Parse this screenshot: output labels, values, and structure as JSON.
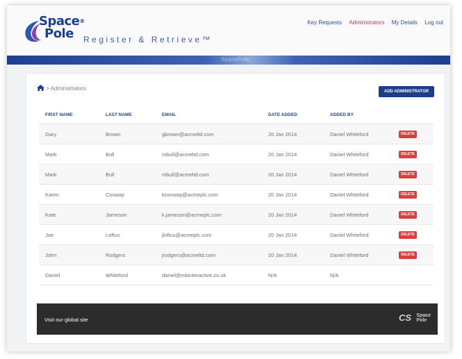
{
  "brand": {
    "line1": "Space",
    "line2": "Pole",
    "reg": "®",
    "tagline": "Register & Retrieve™",
    "band_label": "SpacePole"
  },
  "nav": [
    {
      "label": "Key Requests"
    },
    {
      "label": "Administrators",
      "active": true
    },
    {
      "label": "My Details"
    },
    {
      "label": "Log out"
    }
  ],
  "breadcrumb": {
    "text": "> Administrators"
  },
  "add_button": "ADD ADMINISTRATOR",
  "table": {
    "headers": [
      "FIRST NAME",
      "LAST NAME",
      "EMAIL",
      "DATE ADDED",
      "ADDED BY",
      ""
    ],
    "rows": [
      {
        "first": "Gary",
        "last": "Brown",
        "email": "gbrown@acmeltd.com",
        "date": "20 Jan 2014",
        "added_by": "Daniel Whiteford",
        "action": "DELETE"
      },
      {
        "first": "Mark",
        "last": "Bull",
        "email": "mbull@acmeltd.com",
        "date": "20 Jan 2014",
        "added_by": "Daniel Whiteford",
        "action": "DELETE"
      },
      {
        "first": "Mark",
        "last": "Bull",
        "email": "mbull@acmeltd.com",
        "date": "20 Jan 2014",
        "added_by": "Daniel Whiteford",
        "action": "DELETE"
      },
      {
        "first": "Karen",
        "last": "Conway",
        "email": "kconway@acmeplc.com",
        "date": "20 Jan 2014",
        "added_by": "Daniel Whiteford",
        "action": "DELETE"
      },
      {
        "first": "Kate",
        "last": "Jameson",
        "email": "k.jameson@acmeplc.com",
        "date": "20 Jan 2014",
        "added_by": "Daniel Whiteford",
        "action": "DELETE"
      },
      {
        "first": "Joe",
        "last": "Loftus",
        "email": "jloftus@acmeplc.com",
        "date": "20 Jan 2014",
        "added_by": "Daniel Whiteford",
        "action": "DELETE"
      },
      {
        "first": "John",
        "last": "Rodgers",
        "email": "jrodgers@acmeltd.com",
        "date": "20 Jan 2014",
        "added_by": "Daniel Whiteford",
        "action": "DELETE"
      },
      {
        "first": "Daniel",
        "last": "Whiteford",
        "email": "daniel@mbinteractive.co.uk",
        "date": "N/A",
        "added_by": "N/A",
        "action": ""
      }
    ]
  },
  "footer": {
    "link": "Visit our global site",
    "logo1": "CS",
    "logo2a": "Space",
    "logo2b": "Pole"
  },
  "colors": {
    "brand_blue": "#1c3f8f",
    "active_nav": "#c8394f",
    "delete_red": "#d8403f",
    "footer_bg": "#2c2c2c"
  },
  "icons": {
    "home": "home-icon",
    "logo": "spacepole-swoosh-icon"
  }
}
